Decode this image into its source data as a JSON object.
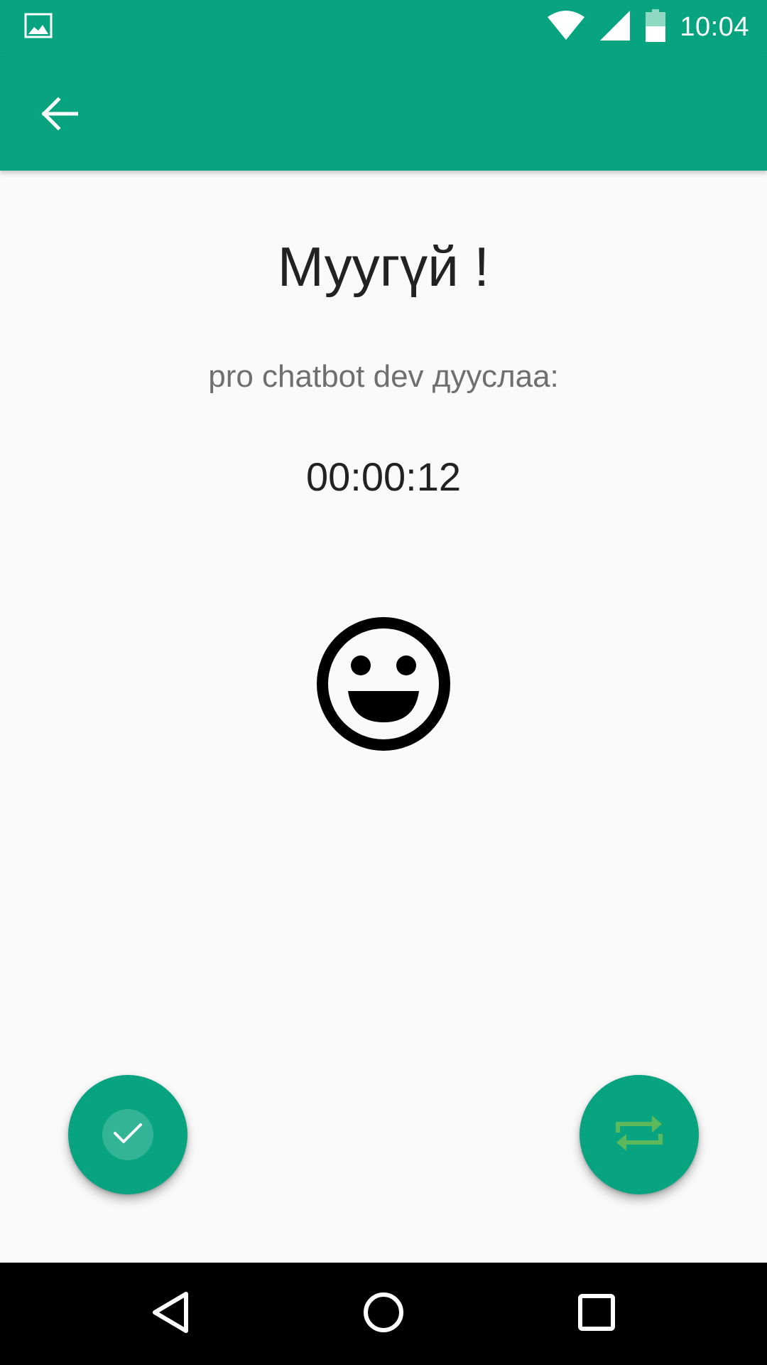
{
  "status_bar": {
    "time": "10:04",
    "icons": [
      "gallery-notification-icon",
      "wifi-icon",
      "signal-icon",
      "battery-icon"
    ]
  },
  "app_bar": {
    "back_icon": "arrow-back-icon"
  },
  "content": {
    "title": "Муугүй !",
    "subtitle": "pro chatbot dev дууслаа:",
    "timer": "00:00:12",
    "emoji_icon": "smiley-icon"
  },
  "actions": {
    "confirm_icon": "check-icon",
    "repeat_icon": "repeat-icon"
  },
  "nav_bar": {
    "icons": [
      "back-triangle-icon",
      "home-circle-icon",
      "recents-square-icon"
    ]
  },
  "colors": {
    "primary": "#07a47f",
    "background": "#fafafa",
    "text_primary": "#222222",
    "text_secondary": "#6f6f6f",
    "repeat_icon": "#5db85c"
  }
}
